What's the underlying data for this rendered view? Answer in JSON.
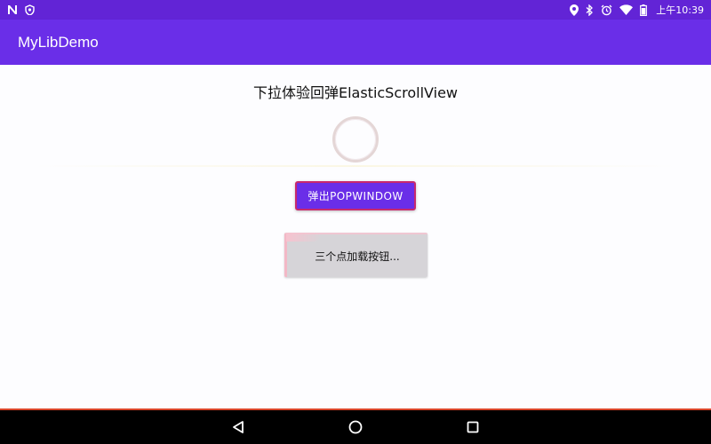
{
  "status_bar": {
    "time": "上午10:39",
    "icons": [
      "n-notification-icon",
      "shield-notification-icon",
      "location-icon",
      "bluetooth-icon",
      "alarm-icon",
      "wifi-icon",
      "battery-icon"
    ],
    "color": "#6224d6"
  },
  "app_bar": {
    "title": "MyLibDemo",
    "color": "#6a2ee8"
  },
  "main": {
    "heading": "下拉体验回弹ElasticScrollView",
    "popup_button_label": "弹出POPWINDOW",
    "dots_button_label": "三个点加载按钮..."
  },
  "nav_bar": {
    "buttons": [
      "back-icon",
      "home-icon",
      "recents-icon"
    ]
  }
}
